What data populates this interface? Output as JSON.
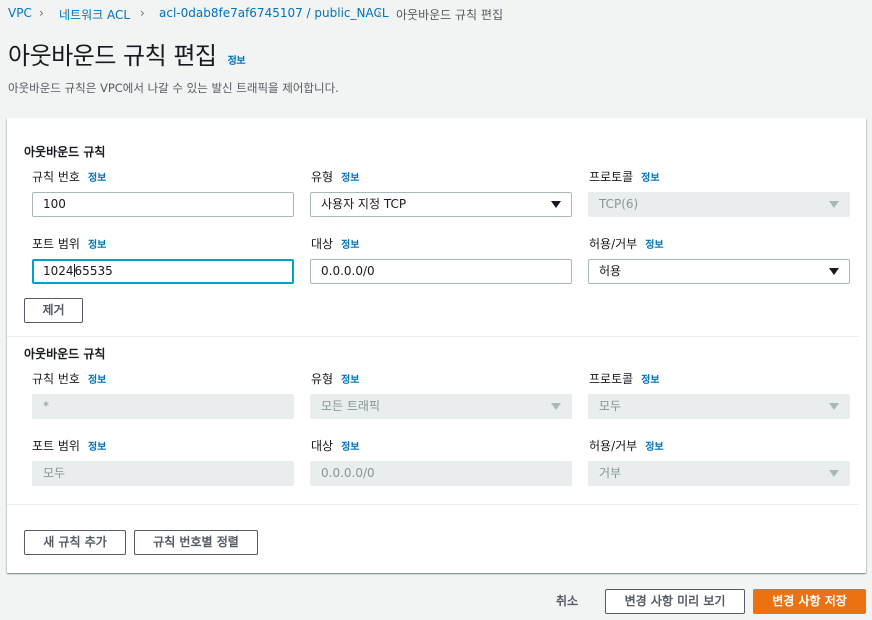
{
  "breadcrumb": {
    "items": [
      "VPC",
      "네트워크 ACL",
      "acl-0dab8fe7af6745107 / public_NACL",
      "아웃바운드 규칙 편집"
    ]
  },
  "header": {
    "title": "아웃바운드 규칙 편집",
    "info": "정보",
    "description": "아웃바운드 규칙은 VPC에서 나갈 수 있는 발신 트래픽을 제어합니다."
  },
  "editable_rule": {
    "section_title": "아웃바운드 규칙",
    "rule_number_label": "규칙 번호",
    "rule_number_value": "100",
    "type_label": "유형",
    "type_value": "사용자 지정 TCP",
    "protocol_label": "프로토콜",
    "protocol_value": "TCP(6)",
    "port_range_label": "포트 범위",
    "port_range_value_a": "1024",
    "port_range_value_b": "65535",
    "destination_label": "대상",
    "destination_value": "0.0.0.0/0",
    "allow_deny_label": "허용/거부",
    "allow_deny_value": "허용",
    "remove_button": "제거",
    "info": "정보"
  },
  "default_rule": {
    "section_title": "아웃바운드 규칙",
    "rule_number_label": "규칙 번호",
    "rule_number_value": "*",
    "type_label": "유형",
    "type_value": "모든 트래픽",
    "protocol_label": "프로토콜",
    "protocol_value": "모두",
    "port_range_label": "포트 범위",
    "port_range_value": "모두",
    "destination_label": "대상",
    "destination_value": "0.0.0.0/0",
    "allow_deny_label": "허용/거부",
    "allow_deny_value": "거부",
    "info": "정보"
  },
  "panel_actions": {
    "add_rule": "새 규칙 추가",
    "sort_rules": "규칙 번호별 정렬"
  },
  "footer": {
    "cancel": "취소",
    "preview": "변경 사항 미리 보기",
    "save": "변경 사항 저장"
  },
  "colors": {
    "link": "#0073bb",
    "primary": "#ec7211",
    "focus": "#00a1c9"
  }
}
